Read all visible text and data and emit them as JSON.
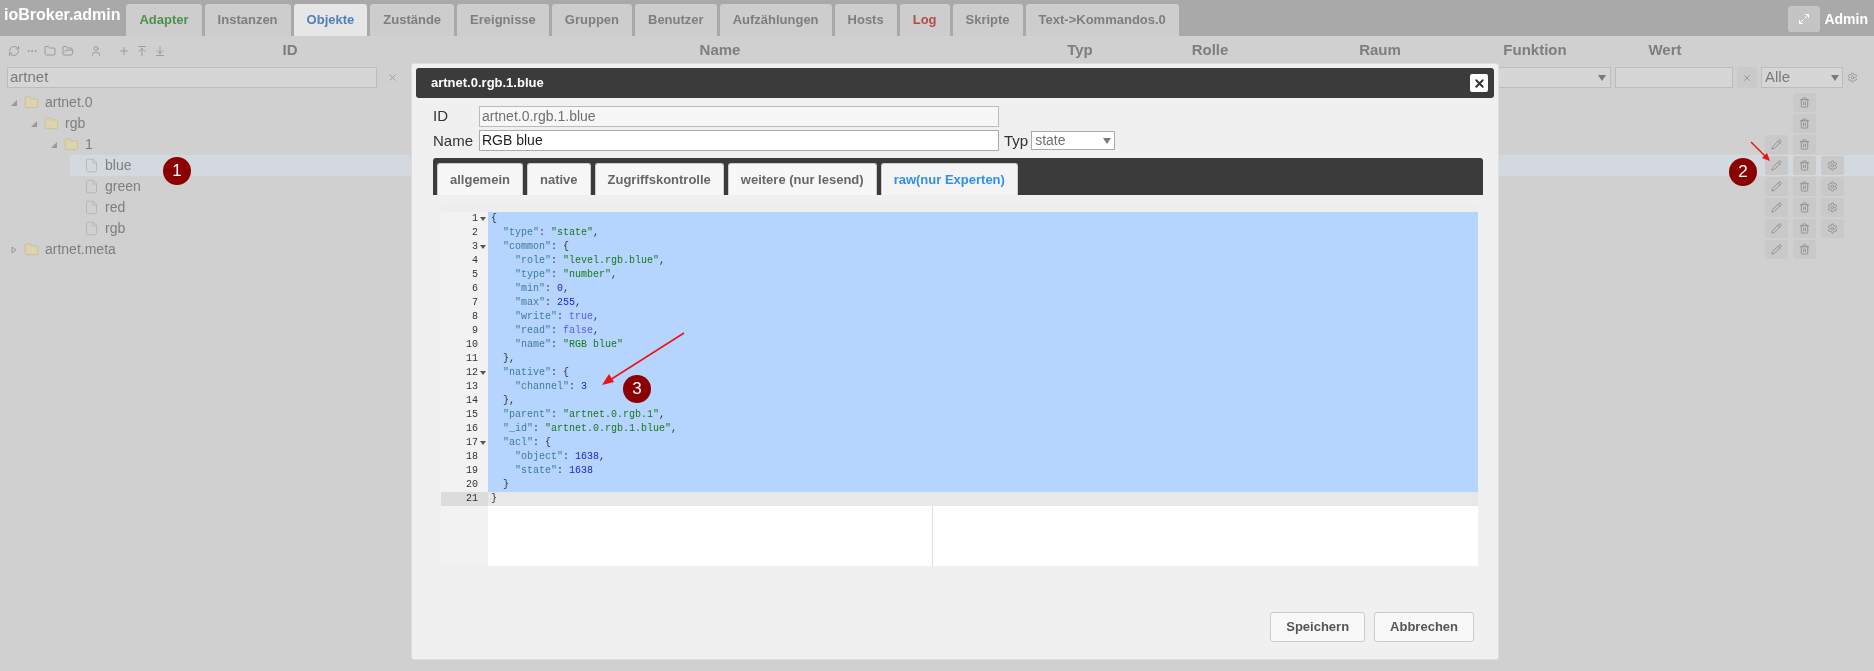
{
  "app": {
    "title": "ioBroker.admin",
    "admin_label": "Admin"
  },
  "nav_tabs": [
    {
      "label": "Adapter",
      "selected": false,
      "color": "#4f8f4f"
    },
    {
      "label": "Instanzen",
      "selected": false,
      "color": "#7e7e7e"
    },
    {
      "label": "Objekte",
      "selected": true,
      "color": "#4f7fb8"
    },
    {
      "label": "Zustände",
      "selected": false,
      "color": "#7e7e7e"
    },
    {
      "label": "Ereignisse",
      "selected": false,
      "color": "#7e7e7e"
    },
    {
      "label": "Gruppen",
      "selected": false,
      "color": "#7e7e7e"
    },
    {
      "label": "Benutzer",
      "selected": false,
      "color": "#7e7e7e"
    },
    {
      "label": "Aufzählungen",
      "selected": false,
      "color": "#7e7e7e"
    },
    {
      "label": "Hosts",
      "selected": false,
      "color": "#7e7e7e"
    },
    {
      "label": "Log",
      "selected": false,
      "color": "#b84a4a"
    },
    {
      "label": "Skripte",
      "selected": false,
      "color": "#7e7e7e"
    },
    {
      "label": "Text->Kommandos.0",
      "selected": false,
      "color": "#7e7e7e"
    }
  ],
  "table": {
    "columns": [
      "ID",
      "Name",
      "Typ",
      "Rolle",
      "Raum",
      "Funktion",
      "Wert"
    ],
    "filters": {
      "id_value": "artnet",
      "value_filter": "Alle"
    }
  },
  "tree": [
    {
      "label": "artnet.0",
      "kind": "folder",
      "expanded": true,
      "selected": false,
      "editable": false,
      "deletable": true,
      "configurable": false,
      "children": [
        {
          "label": "rgb",
          "kind": "folder",
          "expanded": true,
          "selected": false,
          "editable": false,
          "deletable": true,
          "configurable": false,
          "children": [
            {
              "label": "1",
              "kind": "folder",
              "expanded": true,
              "selected": false,
              "editable": true,
              "deletable": true,
              "configurable": false,
              "children": [
                {
                  "label": "blue",
                  "kind": "file",
                  "selected": true,
                  "editable": true,
                  "deletable": true,
                  "configurable": true
                },
                {
                  "label": "green",
                  "kind": "file",
                  "selected": false,
                  "editable": true,
                  "deletable": true,
                  "configurable": true
                },
                {
                  "label": "red",
                  "kind": "file",
                  "selected": false,
                  "editable": true,
                  "deletable": true,
                  "configurable": true
                },
                {
                  "label": "rgb",
                  "kind": "file",
                  "selected": false,
                  "editable": true,
                  "deletable": true,
                  "configurable": true
                }
              ]
            }
          ]
        }
      ]
    },
    {
      "label": "artnet.meta",
      "kind": "folder",
      "expanded": false,
      "selected": false,
      "editable": true,
      "deletable": true,
      "configurable": false
    }
  ],
  "dialog": {
    "title": "artnet.0.rgb.1.blue",
    "id_label": "ID",
    "id_value": "artnet.0.rgb.1.blue",
    "name_label": "Name",
    "name_value": "RGB blue",
    "type_label": "Typ",
    "type_value": "state",
    "tabs": [
      {
        "label": "allgemein",
        "selected": false
      },
      {
        "label": "native",
        "selected": false
      },
      {
        "label": "Zugriffskontrolle",
        "selected": false
      },
      {
        "label": "weitere (nur lesend)",
        "selected": false
      },
      {
        "label": "raw(nur Experten)",
        "selected": true
      }
    ],
    "editor_lines": [
      {
        "num": "1",
        "fold": true,
        "selected": true,
        "active": false,
        "tokens": [
          {
            "kind": "punct",
            "text": "{"
          }
        ]
      },
      {
        "num": "2",
        "fold": false,
        "selected": true,
        "active": false,
        "tokens": [
          {
            "kind": "key",
            "text": "  \"type\""
          },
          {
            "kind": "punct",
            "text": ": "
          },
          {
            "kind": "string",
            "text": "\"state\""
          },
          {
            "kind": "punct",
            "text": ","
          }
        ]
      },
      {
        "num": "3",
        "fold": true,
        "selected": true,
        "active": false,
        "tokens": [
          {
            "kind": "key",
            "text": "  \"common\""
          },
          {
            "kind": "punct",
            "text": ": {"
          }
        ]
      },
      {
        "num": "4",
        "fold": false,
        "selected": true,
        "active": false,
        "tokens": [
          {
            "kind": "key",
            "text": "    \"role\""
          },
          {
            "kind": "punct",
            "text": ": "
          },
          {
            "kind": "string",
            "text": "\"level.rgb.blue\""
          },
          {
            "kind": "punct",
            "text": ","
          }
        ]
      },
      {
        "num": "5",
        "fold": false,
        "selected": true,
        "active": false,
        "tokens": [
          {
            "kind": "key",
            "text": "    \"type\""
          },
          {
            "kind": "punct",
            "text": ": "
          },
          {
            "kind": "string",
            "text": "\"number\""
          },
          {
            "kind": "punct",
            "text": ","
          }
        ]
      },
      {
        "num": "6",
        "fold": false,
        "selected": true,
        "active": false,
        "tokens": [
          {
            "kind": "key",
            "text": "    \"min\""
          },
          {
            "kind": "punct",
            "text": ": "
          },
          {
            "kind": "number",
            "text": "0"
          },
          {
            "kind": "punct",
            "text": ","
          }
        ]
      },
      {
        "num": "7",
        "fold": false,
        "selected": true,
        "active": false,
        "tokens": [
          {
            "kind": "key",
            "text": "    \"max\""
          },
          {
            "kind": "punct",
            "text": ": "
          },
          {
            "kind": "number",
            "text": "255"
          },
          {
            "kind": "punct",
            "text": ","
          }
        ]
      },
      {
        "num": "8",
        "fold": false,
        "selected": true,
        "active": false,
        "tokens": [
          {
            "kind": "key",
            "text": "    \"write\""
          },
          {
            "kind": "punct",
            "text": ": "
          },
          {
            "kind": "boolean",
            "text": "true"
          },
          {
            "kind": "punct",
            "text": ","
          }
        ]
      },
      {
        "num": "9",
        "fold": false,
        "selected": true,
        "active": false,
        "tokens": [
          {
            "kind": "key",
            "text": "    \"read\""
          },
          {
            "kind": "punct",
            "text": ": "
          },
          {
            "kind": "boolean",
            "text": "false"
          },
          {
            "kind": "punct",
            "text": ","
          }
        ]
      },
      {
        "num": "10",
        "fold": false,
        "selected": true,
        "active": false,
        "tokens": [
          {
            "kind": "key",
            "text": "    \"name\""
          },
          {
            "kind": "punct",
            "text": ": "
          },
          {
            "kind": "string",
            "text": "\"RGB blue\""
          }
        ]
      },
      {
        "num": "11",
        "fold": false,
        "selected": true,
        "active": false,
        "tokens": [
          {
            "kind": "punct",
            "text": "  },"
          }
        ]
      },
      {
        "num": "12",
        "fold": true,
        "selected": true,
        "active": false,
        "tokens": [
          {
            "kind": "key",
            "text": "  \"native\""
          },
          {
            "kind": "punct",
            "text": ": {"
          }
        ]
      },
      {
        "num": "13",
        "fold": false,
        "selected": true,
        "active": false,
        "tokens": [
          {
            "kind": "key",
            "text": "    \"channel\""
          },
          {
            "kind": "punct",
            "text": ": "
          },
          {
            "kind": "number",
            "text": "3"
          }
        ]
      },
      {
        "num": "14",
        "fold": false,
        "selected": true,
        "active": false,
        "tokens": [
          {
            "kind": "punct",
            "text": "  },"
          }
        ]
      },
      {
        "num": "15",
        "fold": false,
        "selected": true,
        "active": false,
        "tokens": [
          {
            "kind": "key",
            "text": "  \"parent\""
          },
          {
            "kind": "punct",
            "text": ": "
          },
          {
            "kind": "string",
            "text": "\"artnet.0.rgb.1\""
          },
          {
            "kind": "punct",
            "text": ","
          }
        ]
      },
      {
        "num": "16",
        "fold": false,
        "selected": true,
        "active": false,
        "tokens": [
          {
            "kind": "key",
            "text": "  \"_id\""
          },
          {
            "kind": "punct",
            "text": ": "
          },
          {
            "kind": "string",
            "text": "\"artnet.0.rgb.1.blue\""
          },
          {
            "kind": "punct",
            "text": ","
          }
        ]
      },
      {
        "num": "17",
        "fold": true,
        "selected": true,
        "active": false,
        "tokens": [
          {
            "kind": "key",
            "text": "  \"acl\""
          },
          {
            "kind": "punct",
            "text": ": {"
          }
        ]
      },
      {
        "num": "18",
        "fold": false,
        "selected": true,
        "active": false,
        "tokens": [
          {
            "kind": "key",
            "text": "    \"object\""
          },
          {
            "kind": "punct",
            "text": ": "
          },
          {
            "kind": "number",
            "text": "1638"
          },
          {
            "kind": "punct",
            "text": ","
          }
        ]
      },
      {
        "num": "19",
        "fold": false,
        "selected": true,
        "active": false,
        "tokens": [
          {
            "kind": "key",
            "text": "    \"state\""
          },
          {
            "kind": "punct",
            "text": ": "
          },
          {
            "kind": "number",
            "text": "1638"
          }
        ]
      },
      {
        "num": "20",
        "fold": false,
        "selected": true,
        "active": false,
        "tokens": [
          {
            "kind": "punct",
            "text": "  }"
          }
        ]
      },
      {
        "num": "21",
        "fold": false,
        "selected": false,
        "active": true,
        "tokens": [
          {
            "kind": "punct",
            "text": "}"
          }
        ]
      }
    ],
    "buttons": [
      "Speichern",
      "Abbrechen"
    ]
  },
  "annotations": [
    {
      "label": "1"
    },
    {
      "label": "2"
    },
    {
      "label": "3"
    }
  ]
}
